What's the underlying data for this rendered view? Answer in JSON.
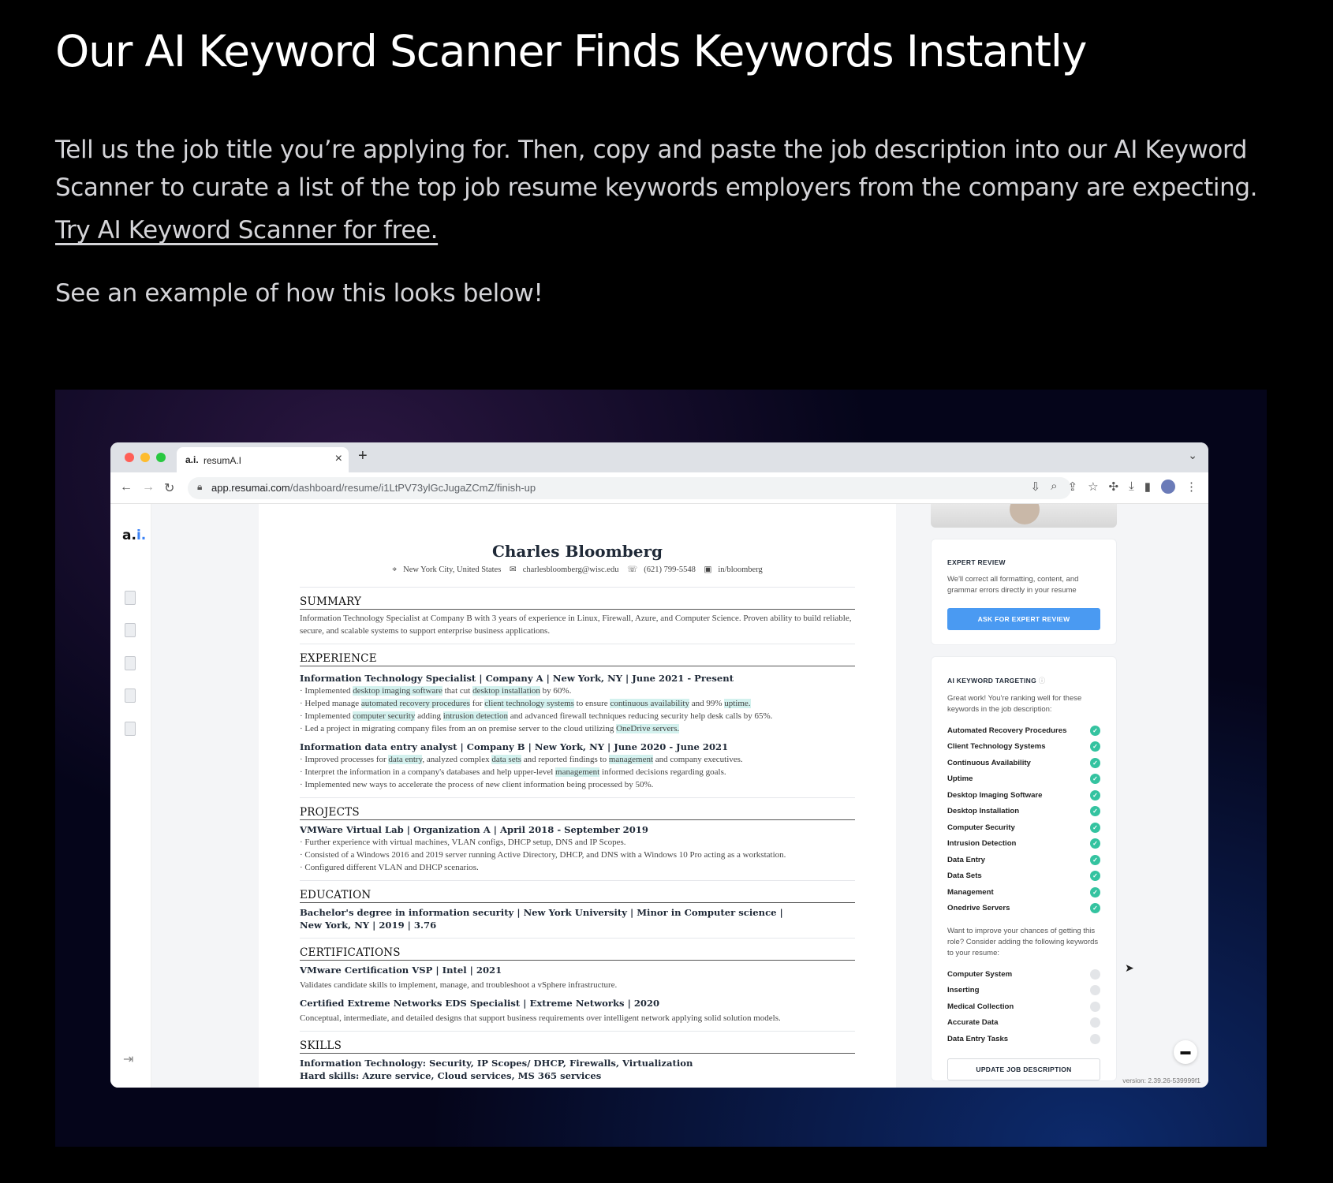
{
  "intro": {
    "heading": "Our AI Keyword Scanner Finds Keywords Instantly",
    "description": "Tell us the job title you’re applying for. Then, copy and paste the job description into our AI Keyword Scanner to curate a list of the top job resume keywords employers from the company are expecting.",
    "cta_link": "Try AI Keyword Scanner for free. ",
    "example_note": "See an example of how this looks below!"
  },
  "browser": {
    "tab_favicon": "a.i.",
    "tab_title": "resumA.I",
    "tab_close": "×",
    "new_tab": "+",
    "tab_menu": "⌄",
    "url_host": "app.resumai.com",
    "url_path": "/dashboard/resume/i1LtPV73ylGcJugaZCmZ/finish-up",
    "colors": {
      "close": "#ff5f57",
      "minimize": "#febc2e",
      "zoom": "#28c840"
    }
  },
  "app": {
    "logo_main": "a.",
    "logo_i": "i.",
    "version": "version: 2.39.26-539999f1"
  },
  "resume": {
    "name": "Charles Bloomberg",
    "contact": {
      "location": "New York City,  United States",
      "email": "charlesbloomberg@wisc.edu",
      "phone": "(621) 799-5548",
      "linkedin": "in/bloomberg"
    },
    "summary": {
      "heading": "SUMMARY",
      "text": "Information Technology Specialist at Company B with 3 years of experience in Linux, Firewall, Azure, and Computer Science. Proven ability to build reliable, secure, and scalable systems to support enterprise business applications."
    },
    "experience": {
      "heading": "EXPERIENCE",
      "job1": {
        "title": "Information Technology Specialist | Company A | New York, NY | June 2021 - Present",
        "b1": [
          "Implemented ",
          "desktop imaging software",
          " that cut ",
          "desktop installation",
          " by 60%."
        ],
        "b2": [
          "Helped manage ",
          "automated recovery procedures",
          " for ",
          "client technology systems",
          " to ensure ",
          "continuous availability",
          " and 99% ",
          "uptime."
        ],
        "b3": [
          "Implemented ",
          "computer security",
          " adding ",
          "intrusion detection",
          " and advanced firewall techniques reducing security help desk calls by 65%."
        ],
        "b4": [
          "Led a project in migrating company files from an on premise server to the cloud utilizing ",
          "OneDrive servers."
        ]
      },
      "job2": {
        "title": "Information data entry analyst | Company B | New York, NY | June 2020 - June 2021",
        "b1": [
          "Improved processes for ",
          "data entry",
          ", analyzed complex ",
          "data sets",
          " and reported findings to ",
          "management",
          " and company executives."
        ],
        "b2": [
          "Interpret the information in a company's databases and help upper-level ",
          "management",
          " informed decisions regarding goals."
        ],
        "b3": "Implemented new ways to accelerate the process of new client information being processed by 50%."
      }
    },
    "projects": {
      "heading": "PROJECTS",
      "title": "VMWare Virtual Lab | Organization A | April 2018 - September 2019",
      "bullets": [
        "Further experience with virtual machines, VLAN configs, DHCP setup, DNS and IP Scopes.",
        "Consisted of a Windows 2016 and 2019 server running Active Directory, DHCP, and DNS with a Windows 10 Pro acting as a workstation.",
        "Configured different VLAN and DHCP scenarios."
      ]
    },
    "education": {
      "heading": "EDUCATION",
      "title": "Bachelor's degree in information security | New York University | Minor in Computer science | New York, NY | 2019 | 3.76"
    },
    "certifications": {
      "heading": "CERTIFICATIONS",
      "c1_title": "VMware Certification VSP | Intel | 2021",
      "c1_desc": "Validates candidate skills to implement, manage, and troubleshoot a vSphere infrastructure.",
      "c2_title": "Certified Extreme Networks EDS Specialist | Extreme Networks | 2020",
      "c2_desc": "Conceptual, intermediate, and detailed designs that support business requirements over intelligent network applying solid solution models."
    },
    "skills": {
      "heading": "SKILLS",
      "line1": "Information Technology: Security, IP Scopes/ DHCP, Firewalls, Virtualization",
      "line2": "Hard skills: Azure service, Cloud services, MS 365 services"
    }
  },
  "expert_review": {
    "heading": "EXPERT REVIEW",
    "text": "We'll correct all formatting, content, and grammar errors directly in your resume",
    "button": "ASK FOR EXPERT REVIEW"
  },
  "keyword_targeting": {
    "heading": "AI KEYWORD TARGETING",
    "found_text": "Great work! You're ranking well for these keywords in the job description:",
    "found": [
      "Automated Recovery Procedures",
      "Client Technology Systems",
      "Continuous Availability",
      "Uptime",
      "Desktop Imaging Software",
      "Desktop Installation",
      "Computer Security",
      "Intrusion Detection",
      "Data Entry",
      "Data Sets",
      "Management",
      "Onedrive Servers"
    ],
    "missing_text": "Want to improve your chances of getting this role? Consider adding the following keywords to your resume:",
    "missing": [
      "Computer System",
      "Inserting",
      "Medical Collection",
      "Accurate Data",
      "Data Entry Tasks"
    ],
    "button": "UPDATE JOB DESCRIPTION"
  }
}
